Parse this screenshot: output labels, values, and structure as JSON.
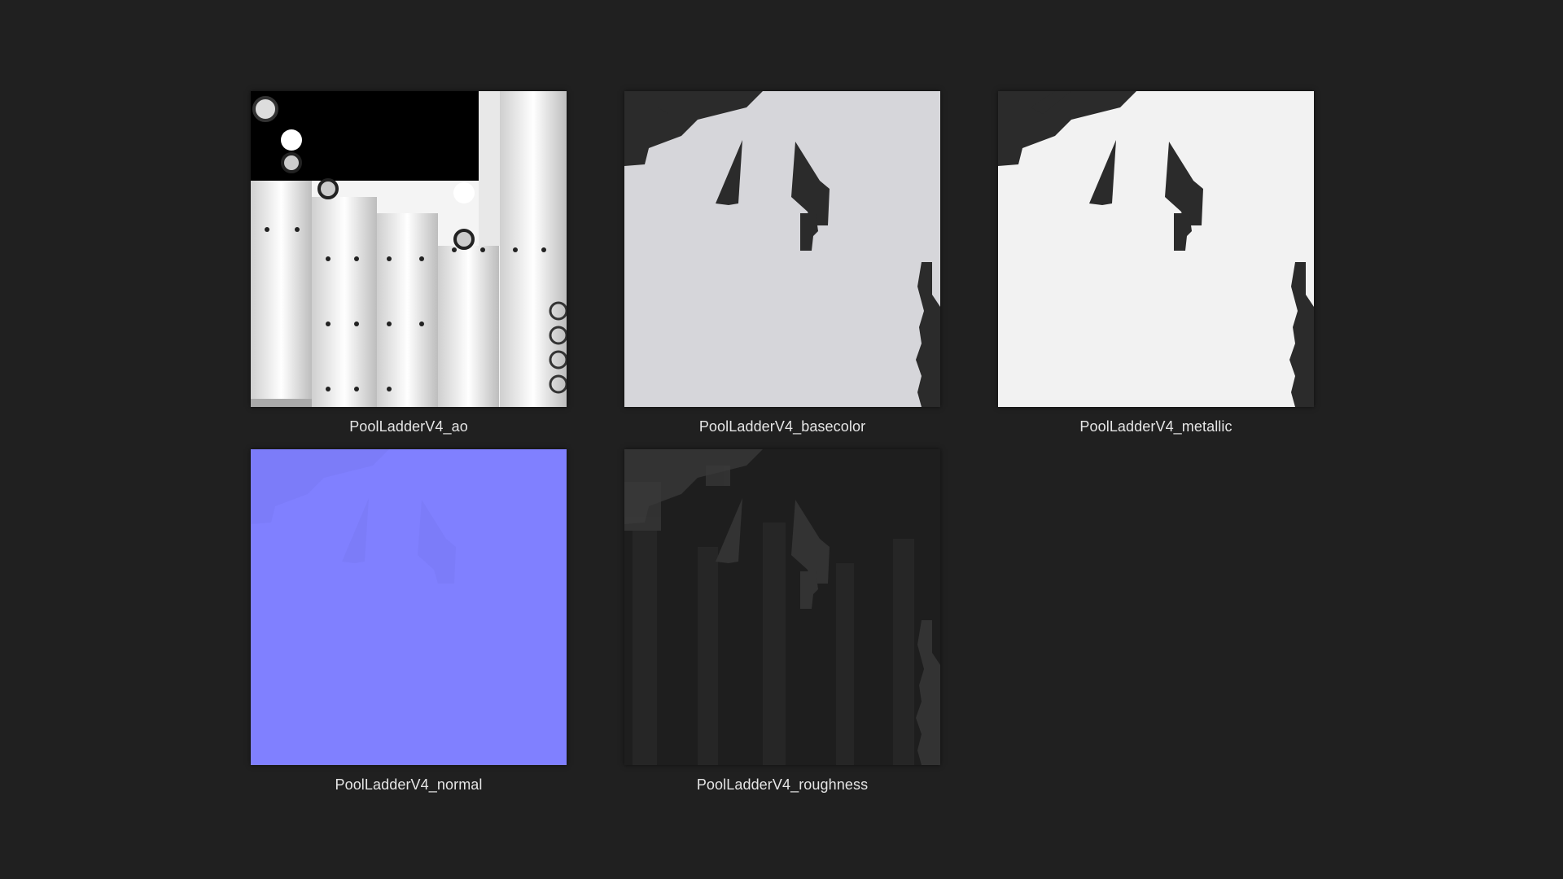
{
  "files": [
    {
      "name": "PoolLadderV4_ao",
      "icon": "ao-texture-thumbnail",
      "color": "#f2f2f2"
    },
    {
      "name": "PoolLadderV4_basecolor",
      "icon": "basecolor-texture-thumbnail",
      "color": "#d6d6da"
    },
    {
      "name": "PoolLadderV4_metallic",
      "icon": "metallic-texture-thumbnail",
      "color": "#f2f2f2"
    },
    {
      "name": "PoolLadderV4_normal",
      "icon": "normal-texture-thumbnail",
      "color": "#8080ff"
    },
    {
      "name": "PoolLadderV4_roughness",
      "icon": "roughness-texture-thumbnail",
      "color": "#1e1e1e"
    }
  ],
  "colors": {
    "background": "#202020",
    "label": "#e6e6e6",
    "shape_dark": "#2b2b2b"
  }
}
